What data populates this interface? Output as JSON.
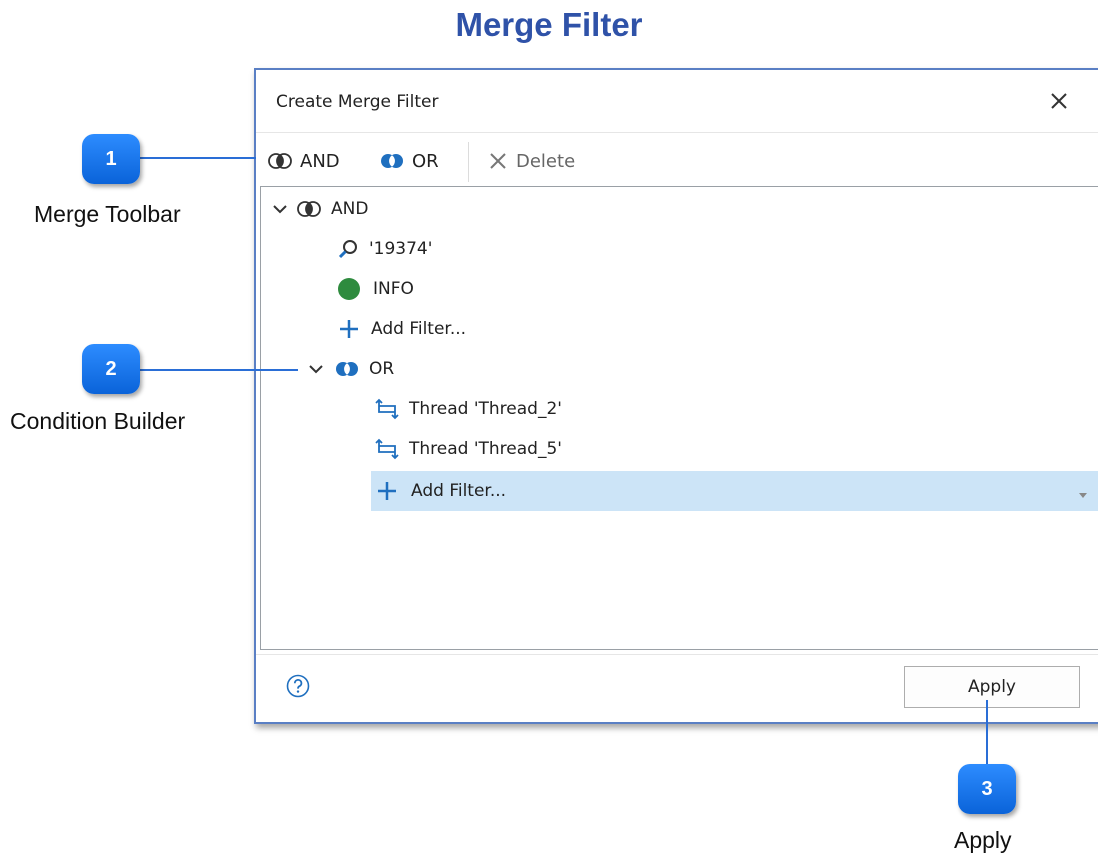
{
  "page_title": "Merge Filter",
  "dialog": {
    "title": "Create Merge Filter",
    "toolbar": {
      "and_label": "AND",
      "or_label": "OR",
      "delete_label": "Delete"
    },
    "tree": {
      "root_label": "AND",
      "items": [
        "'19374'",
        "INFO",
        "Add Filter..."
      ],
      "or_group_label": "OR",
      "or_items": [
        "Thread 'Thread_2'",
        "Thread 'Thread_5'",
        "Add Filter..."
      ]
    },
    "apply_label": "Apply"
  },
  "callouts": [
    {
      "number": "1",
      "label": "Merge Toolbar"
    },
    {
      "number": "2",
      "label": "Condition Builder"
    },
    {
      "number": "3",
      "label": "Apply"
    }
  ],
  "colors": {
    "accent": "#1a73e8",
    "info_dot": "#2e8b3e",
    "icon_blue": "#1f6fbf",
    "selected_row": "#cce4f7",
    "title_blue": "#2f52a8"
  }
}
